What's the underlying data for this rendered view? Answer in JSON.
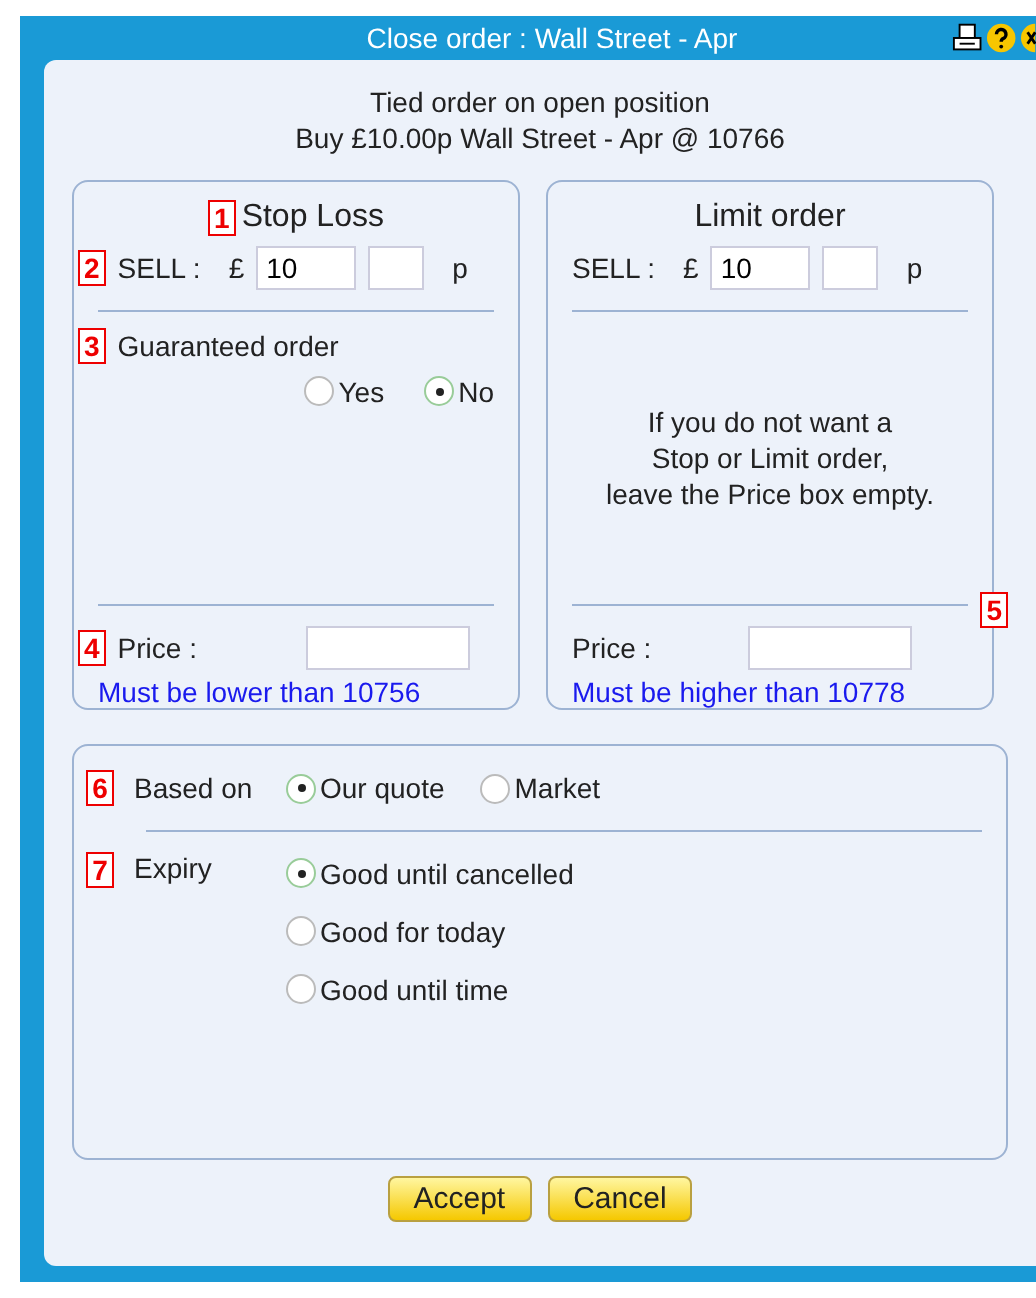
{
  "window": {
    "title": "Close order : Wall Street - Apr"
  },
  "header": [
    "Tied order on open position",
    "Buy £10.00p Wall Street - Apr @ 10766"
  ],
  "panels": [
    {
      "kind": "stop",
      "marker": "1",
      "title": "Stop Loss",
      "sell": {
        "marker": "2",
        "label": "SELL :",
        "currency": "£",
        "pounds": "10",
        "unit": "p"
      },
      "guaranteed": {
        "marker": "3",
        "label": "Guaranteed order",
        "options": [
          {
            "label": "Yes",
            "selected": false
          },
          {
            "label": "No",
            "selected": true
          }
        ]
      },
      "price": {
        "marker": "4",
        "label": "Price :",
        "hint": "Must be lower than 10756"
      }
    },
    {
      "kind": "limit",
      "title": "Limit order",
      "sell": {
        "label": "SELL :",
        "currency": "£",
        "pounds": "10",
        "unit": "p"
      },
      "note": [
        "If you do not want a",
        "Stop or Limit order,",
        "leave the Price box empty."
      ],
      "price": {
        "marker": "5",
        "label": "Price :",
        "hint": "Must be higher than 10778"
      }
    }
  ],
  "based_on": {
    "marker": "6",
    "label": "Based on",
    "options": [
      {
        "label": "Our quote",
        "selected": true
      },
      {
        "label": "Market",
        "selected": false
      }
    ]
  },
  "expiry": {
    "marker": "7",
    "label": "Expiry",
    "options": [
      {
        "label": "Good until cancelled",
        "selected": true
      },
      {
        "label": "Good for today",
        "selected": false
      },
      {
        "label": "Good until time",
        "selected": false
      }
    ]
  },
  "buttons": [
    "Accept",
    "Cancel"
  ]
}
